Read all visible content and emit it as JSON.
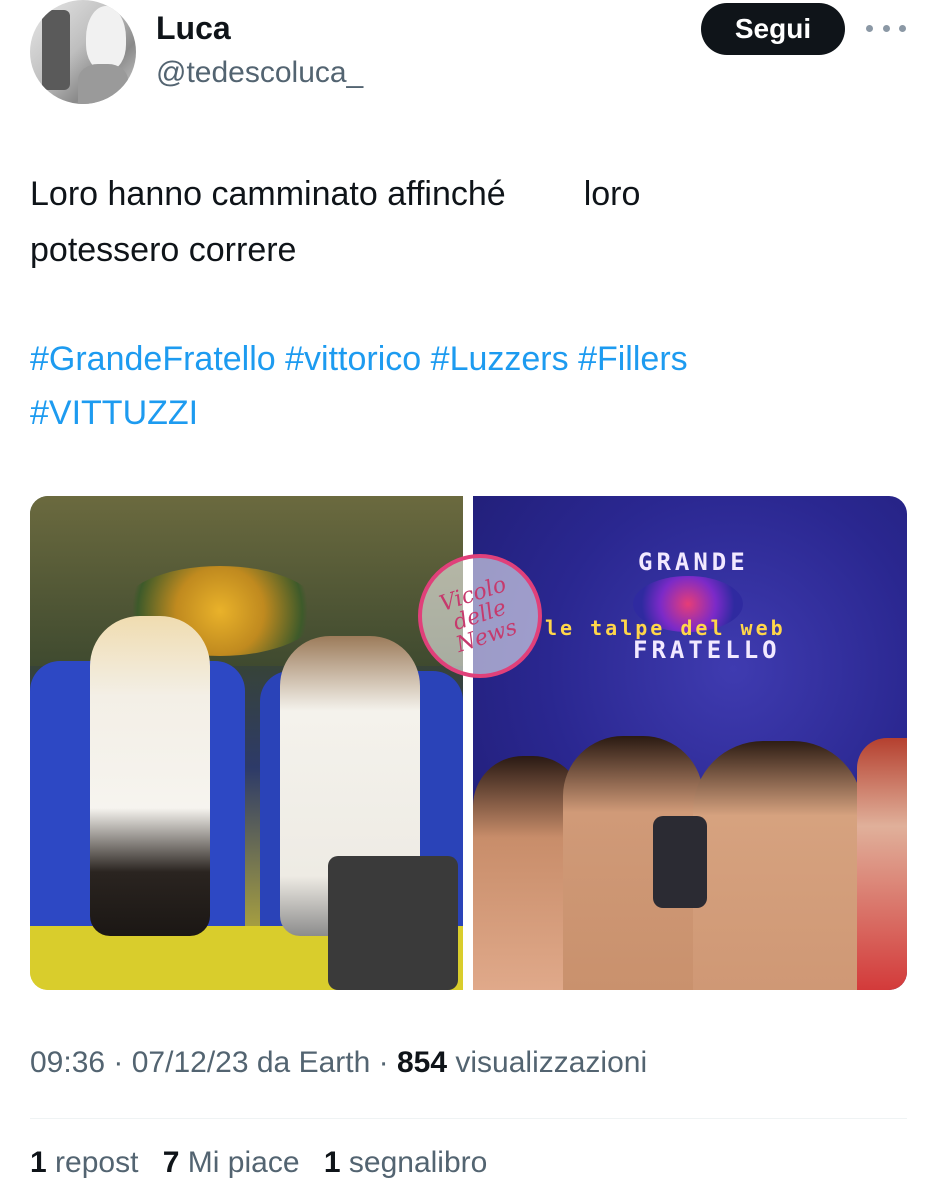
{
  "author": {
    "name": "Luca",
    "handle": "@tedescoluca_"
  },
  "actions": {
    "follow_label": "Segui",
    "more_icon": "more-horizontal-icon"
  },
  "tweet": {
    "line1_a": "Loro hanno camminato affinché",
    "line1_b": "loro",
    "line2": "potessero correre",
    "hashtags": [
      "#GrandeFratello",
      "#vittorico",
      "#Luzzers",
      "#Fillers",
      "#VITTUZZI"
    ]
  },
  "media": {
    "right_logo_top": "GRANDE",
    "right_logo_bottom": "FRATELLO",
    "watermark": "Vicolo delle News",
    "watermark2": "le talpe del web"
  },
  "meta": {
    "time": "09:36",
    "date": "07/12/23",
    "source": "da Earth",
    "views_count": "854",
    "views_label": "visualizzazioni"
  },
  "stats": {
    "reposts_count": "1",
    "reposts_label": "repost",
    "likes_count": "7",
    "likes_label": "Mi piace",
    "bookmarks_count": "1",
    "bookmarks_label": "segnalibro"
  },
  "colors": {
    "link": "#1d9bf0",
    "secondary_text": "#536471",
    "primary_text": "#0f1419"
  }
}
